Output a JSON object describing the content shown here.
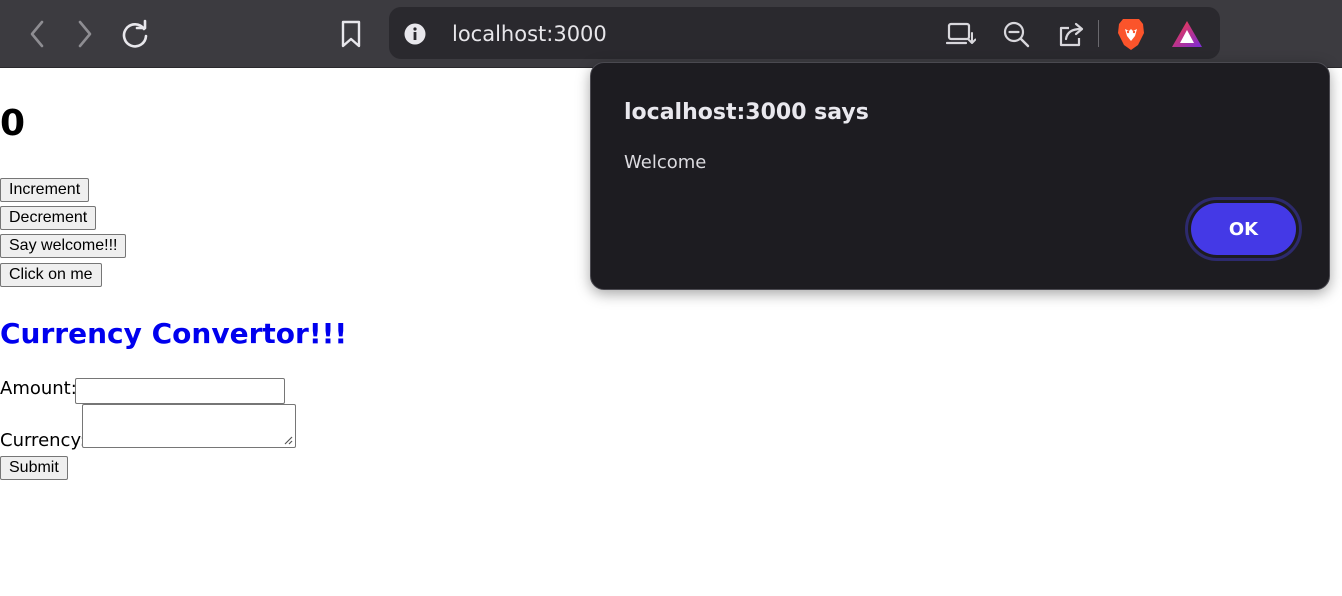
{
  "browser": {
    "url": "localhost:3000",
    "icons": {
      "back": "back-arrow-icon",
      "forward": "forward-arrow-icon",
      "reload": "reload-icon",
      "bookmark": "bookmark-icon",
      "site_info": "info-icon",
      "install": "install-app-icon",
      "zoom": "zoom-out-icon",
      "share": "share-icon",
      "brave_shields": "brave-lion-icon",
      "rewards": "brave-rewards-icon"
    }
  },
  "page": {
    "counter_value": "0",
    "buttons": {
      "increment": "Increment",
      "decrement": "Decrement",
      "welcome": "Say welcome!!!",
      "click_me": "Click on me"
    },
    "converter": {
      "title": "Currency Convertor!!!",
      "amount_label": "Amount:",
      "amount_value": "",
      "currency_label": "Currency:",
      "currency_value": "",
      "submit_label": "Submit"
    },
    "colors": {
      "heading": "#0000ee"
    }
  },
  "alert": {
    "title": "localhost:3000 says",
    "message": "Welcome",
    "ok_label": "OK",
    "ok_color": "#4439e6"
  }
}
